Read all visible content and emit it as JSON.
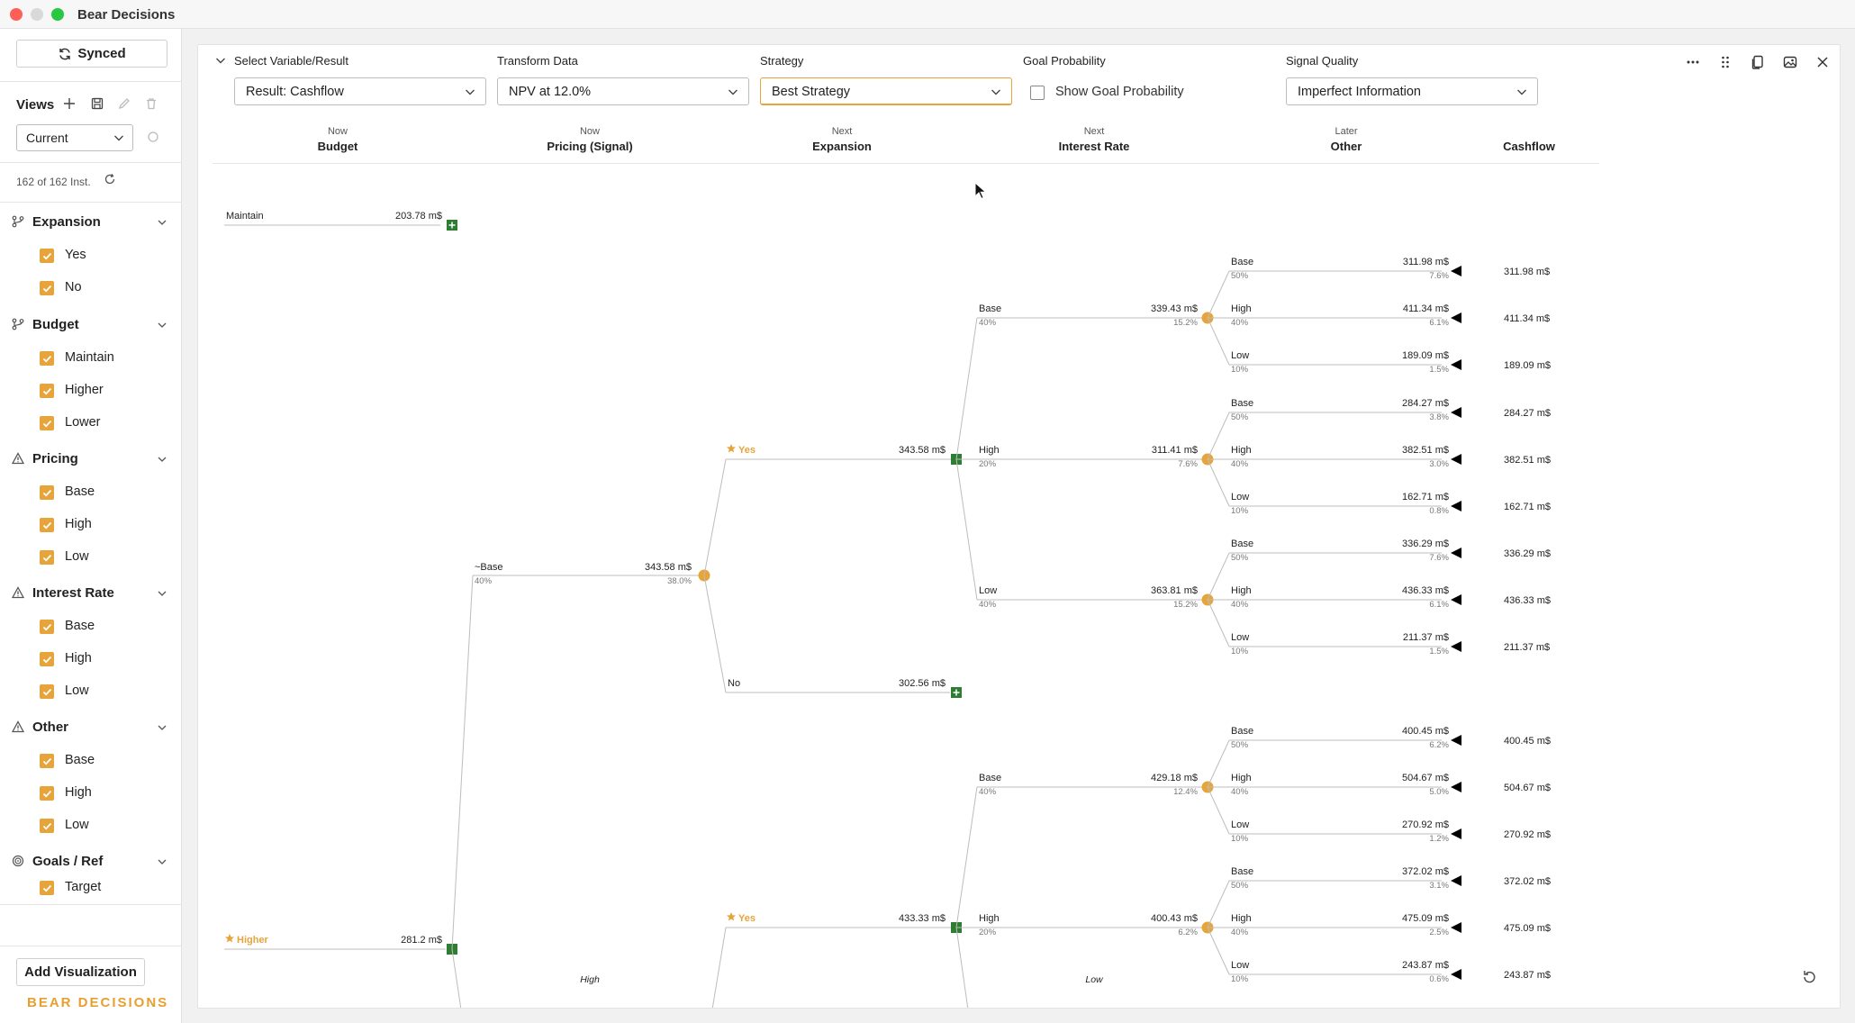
{
  "window": {
    "title": "Bear Decisions"
  },
  "sidebar": {
    "synced_label": "Synced",
    "views_label": "Views",
    "current_view": "Current",
    "instances": "162 of 162 Inst.",
    "sections": [
      {
        "title": "Expansion",
        "icon": "branch-icon",
        "items": [
          "Yes",
          "No"
        ]
      },
      {
        "title": "Budget",
        "icon": "branch-icon",
        "items": [
          "Maintain",
          "Higher",
          "Lower"
        ]
      },
      {
        "title": "Pricing",
        "icon": "warning-icon",
        "items": [
          "Base",
          "High",
          "Low"
        ]
      },
      {
        "title": "Interest Rate",
        "icon": "warning-icon",
        "items": [
          "Base",
          "High",
          "Low"
        ]
      },
      {
        "title": "Other",
        "icon": "warning-icon",
        "items": [
          "Base",
          "High",
          "Low"
        ]
      },
      {
        "title": "Goals / Ref",
        "icon": "target-icon",
        "items": [
          "Target"
        ]
      }
    ],
    "add_visualization": "Add Visualization",
    "brand": "BEAR DECISIONS"
  },
  "controls": {
    "variable": {
      "label": "Select Variable/Result",
      "value": "Result: Cashflow"
    },
    "transform": {
      "label": "Transform Data",
      "value": "NPV at 12.0%"
    },
    "strategy": {
      "label": "Strategy",
      "value": "Best Strategy"
    },
    "goal": {
      "label": "Goal Probability",
      "checkbox_label": "Show Goal Probability"
    },
    "signal": {
      "label": "Signal Quality",
      "value": "Imperfect Information"
    }
  },
  "columns": [
    {
      "when": "Now",
      "name": "Budget"
    },
    {
      "when": "Now",
      "name": "Pricing (Signal)"
    },
    {
      "when": "Next",
      "name": "Expansion"
    },
    {
      "when": "Next",
      "name": "Interest Rate"
    },
    {
      "when": "Later",
      "name": "Other"
    },
    {
      "when": "",
      "name": "Cashflow"
    }
  ],
  "tree": {
    "budget": [
      {
        "label": "Maintain",
        "value": "203.78 m$",
        "star": false
      },
      {
        "label": "Higher",
        "value": "281.2 m$",
        "star": true
      }
    ],
    "pricing": {
      "label": "~Base",
      "prob": "40%",
      "value": "343.58 m$",
      "pct": "38.0%"
    },
    "expansion": [
      {
        "label": "Yes",
        "value": "343.58 m$",
        "star": true
      },
      {
        "label": "No",
        "value": "302.56 m$",
        "star": false
      },
      {
        "label": "Yes",
        "value": "433.33 m$",
        "star": true
      }
    ],
    "rate_groups": [
      {
        "rates": [
          {
            "label": "Base",
            "prob": "40%",
            "value": "339.43 m$",
            "pct": "15.2%",
            "leaves": [
              {
                "label": "Base",
                "prob": "50%",
                "value": "311.98 m$",
                "pct": "7.6%",
                "cash": "311.98 m$"
              },
              {
                "label": "High",
                "prob": "40%",
                "value": "411.34 m$",
                "pct": "6.1%",
                "cash": "411.34 m$"
              },
              {
                "label": "Low",
                "prob": "10%",
                "value": "189.09 m$",
                "pct": "1.5%",
                "cash": "189.09 m$"
              }
            ]
          },
          {
            "label": "High",
            "prob": "20%",
            "value": "311.41 m$",
            "pct": "7.6%",
            "leaves": [
              {
                "label": "Base",
                "prob": "50%",
                "value": "284.27 m$",
                "pct": "3.8%",
                "cash": "284.27 m$"
              },
              {
                "label": "High",
                "prob": "40%",
                "value": "382.51 m$",
                "pct": "3.0%",
                "cash": "382.51 m$"
              },
              {
                "label": "Low",
                "prob": "10%",
                "value": "162.71 m$",
                "pct": "0.8%",
                "cash": "162.71 m$"
              }
            ]
          },
          {
            "label": "Low",
            "prob": "40%",
            "value": "363.81 m$",
            "pct": "15.2%",
            "leaves": [
              {
                "label": "Base",
                "prob": "50%",
                "value": "336.29 m$",
                "pct": "7.6%",
                "cash": "336.29 m$"
              },
              {
                "label": "High",
                "prob": "40%",
                "value": "436.33 m$",
                "pct": "6.1%",
                "cash": "436.33 m$"
              },
              {
                "label": "Low",
                "prob": "10%",
                "value": "211.37 m$",
                "pct": "1.5%",
                "cash": "211.37 m$"
              }
            ]
          }
        ]
      },
      {
        "rates": [
          {
            "label": "Base",
            "prob": "40%",
            "value": "429.18 m$",
            "pct": "12.4%",
            "leaves": [
              {
                "label": "Base",
                "prob": "50%",
                "value": "400.45 m$",
                "pct": "6.2%",
                "cash": "400.45 m$"
              },
              {
                "label": "High",
                "prob": "40%",
                "value": "504.67 m$",
                "pct": "5.0%",
                "cash": "504.67 m$"
              },
              {
                "label": "Low",
                "prob": "10%",
                "value": "270.92 m$",
                "pct": "1.2%",
                "cash": "270.92 m$"
              }
            ]
          },
          {
            "label": "High",
            "prob": "20%",
            "value": "400.43 m$",
            "pct": "6.2%",
            "leaves": [
              {
                "label": "Base",
                "prob": "50%",
                "value": "372.02 m$",
                "pct": "3.1%",
                "cash": "372.02 m$"
              },
              {
                "label": "High",
                "prob": "40%",
                "value": "475.09 m$",
                "pct": "2.5%",
                "cash": "475.09 m$"
              },
              {
                "label": "Low",
                "prob": "10%",
                "value": "243.87 m$",
                "pct": "0.6%",
                "cash": "243.87 m$"
              }
            ]
          }
        ]
      }
    ],
    "collapsed_labels": [
      "High",
      "Low"
    ]
  },
  "colors": {
    "accent": "#e6a43a",
    "decision": "#2e7d32",
    "terminal": "#000000",
    "line": "#bdbdbd"
  }
}
